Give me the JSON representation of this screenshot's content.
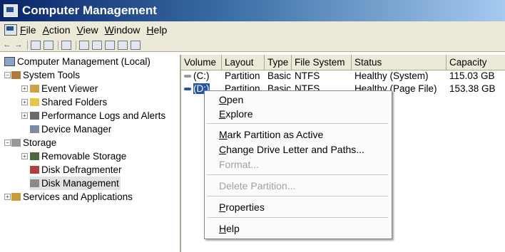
{
  "window": {
    "title": "Computer Management"
  },
  "menu": [
    {
      "label": "File",
      "ul": "F",
      "rest": "ile"
    },
    {
      "label": "Action",
      "ul": "A",
      "rest": "ction"
    },
    {
      "label": "View",
      "ul": "V",
      "rest": "iew"
    },
    {
      "label": "Window",
      "ul": "W",
      "rest": "indow"
    },
    {
      "label": "Help",
      "ul": "H",
      "rest": "elp"
    }
  ],
  "tree": [
    {
      "label": "Computer Management (Local)",
      "icon": "computer-icon"
    },
    {
      "label": "System Tools",
      "icon": "tools-icon"
    },
    {
      "label": "Event Viewer",
      "icon": "event-viewer-icon"
    },
    {
      "label": "Shared Folders",
      "icon": "shared-folders-icon"
    },
    {
      "label": "Performance Logs and Alerts",
      "icon": "performance-icon"
    },
    {
      "label": "Device Manager",
      "icon": "device-manager-icon"
    },
    {
      "label": "Storage",
      "icon": "storage-icon"
    },
    {
      "label": "Removable Storage",
      "icon": "removable-storage-icon"
    },
    {
      "label": "Disk Defragmenter",
      "icon": "defragmenter-icon"
    },
    {
      "label": "Disk Management",
      "icon": "disk-management-icon"
    },
    {
      "label": "Services and Applications",
      "icon": "services-icon"
    }
  ],
  "columns": [
    "Volume",
    "Layout",
    "Type",
    "File System",
    "Status",
    "Capacity"
  ],
  "rows": [
    [
      "(C:)",
      "Partition",
      "Basic",
      "NTFS",
      "Healthy (System)",
      "115.03 GB"
    ],
    [
      "(D:)",
      "Partition",
      "Basic",
      "NTFS",
      "Healthy (Page File)",
      "153.38 GB"
    ]
  ],
  "context_menu": {
    "open": {
      "ul": "O",
      "rest": "pen"
    },
    "explore": {
      "ul": "E",
      "rest": "xplore"
    },
    "mark_active": {
      "ul": "M",
      "rest": "ark Partition as Active"
    },
    "change_letter": {
      "ul": "C",
      "rest": "hange Drive Letter and Paths..."
    },
    "format": {
      "ul": "",
      "rest": "Format..."
    },
    "delete": {
      "ul": "",
      "rest": "Delete Partition..."
    },
    "properties": {
      "ul": "P",
      "rest": "roperties"
    },
    "help": {
      "ul": "H",
      "rest": "elp"
    }
  },
  "colors": {
    "title_start": "#0a246a",
    "selection": "#2456a6",
    "chrome": "#ece9d8"
  }
}
